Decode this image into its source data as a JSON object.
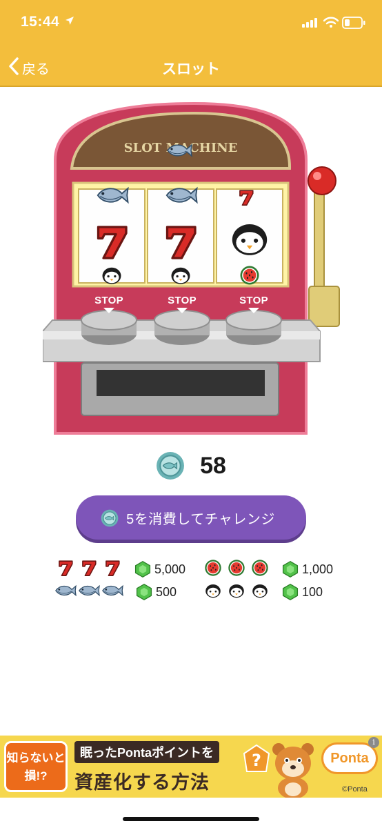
{
  "status_bar": {
    "time": "15:44",
    "icons": [
      "location-arrow-icon",
      "cellular-signal-icon",
      "wifi-icon",
      "battery-icon"
    ]
  },
  "nav": {
    "back_label": "戻る",
    "title": "スロット"
  },
  "machine": {
    "marquee": "SLOT MACHINE",
    "reels": [
      [
        "fish",
        "seven",
        "penguin"
      ],
      [
        "fish",
        "seven",
        "penguin"
      ],
      [
        "seven",
        "penguin",
        "watermelon"
      ]
    ],
    "stop_labels": [
      "STOP",
      "STOP",
      "STOP"
    ]
  },
  "coins": {
    "count": "58"
  },
  "challenge": {
    "label": "5を消費してチャレンジ"
  },
  "prizes": [
    {
      "combo": "seven",
      "amount": "5,000"
    },
    {
      "combo": "watermelon",
      "amount": "1,000"
    },
    {
      "combo": "fish",
      "amount": "500"
    },
    {
      "combo": "penguin",
      "amount": "100"
    }
  ],
  "ad": {
    "tag": "知らないと損!?",
    "line1": "眠ったPontaポイントを",
    "line2": "資産化する方法",
    "brand": "Ponta",
    "copyright": "©Ponta",
    "info": "i"
  },
  "colors": {
    "header": "#f3be3c",
    "machine_body": "#c73b5a",
    "button": "#7e55b9",
    "gem": "#4fc048"
  }
}
